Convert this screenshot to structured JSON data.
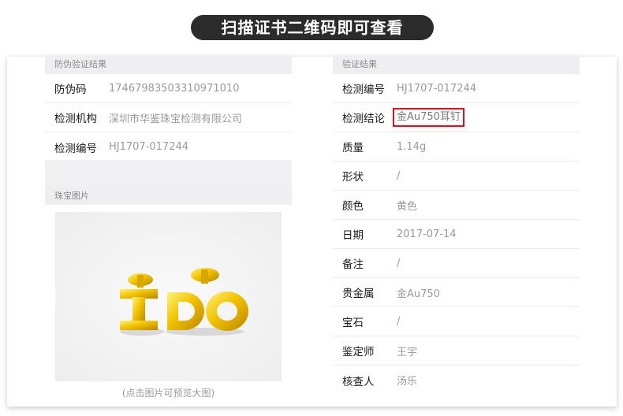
{
  "banner": {
    "title": "扫描证书二维码即可查看"
  },
  "left": {
    "header": "防伪验证结果",
    "rows": [
      {
        "label": "防伪码",
        "value": "17467983503310971010"
      },
      {
        "label": "检测机构",
        "value": "深圳市华鉴珠宝检测有限公司"
      },
      {
        "label": "检测编号",
        "value": "HJ1707-017244"
      }
    ],
    "gem_header": "珠宝图片",
    "photo": {
      "text": "I DO"
    },
    "caption": "(点击图片可预览大图)"
  },
  "right": {
    "header": "验证结果",
    "rows": [
      {
        "label": "检测编号",
        "value": "HJ1707-017244"
      },
      {
        "label": "检测结论",
        "value": "金Au750耳钉"
      },
      {
        "label": "质量",
        "value": "1.14g"
      },
      {
        "label": "形状",
        "value": "/"
      },
      {
        "label": "颜色",
        "value": "黄色"
      },
      {
        "label": "日期",
        "value": "2017-07-14"
      },
      {
        "label": "备注",
        "value": "/"
      },
      {
        "label": "贵金属",
        "value": "金Au750"
      },
      {
        "label": "宝石",
        "value": "/"
      },
      {
        "label": "鉴定师",
        "value": "王宇"
      },
      {
        "label": "核查人",
        "value": "汤乐"
      }
    ]
  },
  "colors": {
    "highlight": "#d8101c",
    "banner": "#2b2b2b",
    "gold": "#f2c200"
  }
}
